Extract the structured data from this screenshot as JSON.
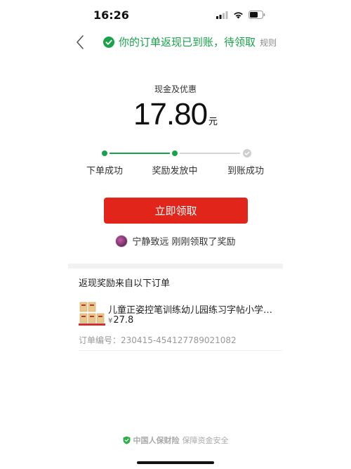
{
  "status_bar": {
    "time": "16:26"
  },
  "nav": {
    "title": "你的订单返现已到账，待领取",
    "rules": "规则"
  },
  "reward": {
    "label": "现金及优惠",
    "amount": "17.80",
    "unit": "元"
  },
  "progress": {
    "steps": [
      {
        "label": "下单成功",
        "state": "done"
      },
      {
        "label": "奖励发放中",
        "state": "current"
      },
      {
        "label": "到账成功",
        "state": "pending"
      }
    ]
  },
  "claim_button": "立即领取",
  "notice": {
    "text": "宁静致远 刚刚领取了奖励"
  },
  "orders_section": {
    "title": "返现奖励来自以下订单",
    "order": {
      "name": "儿童正姿控笔训练幼儿园练习字帖小学生描红...",
      "currency": "¥",
      "price": "27.8",
      "order_no_label": "订单编号：",
      "order_no": "230415-454127789021082"
    }
  },
  "footer": {
    "brand": "中国人保财险",
    "text": "保障资金安全"
  },
  "colors": {
    "accent_green": "#18a34a",
    "button_red": "#e1251b",
    "progress_pending": "#cfcfcf"
  }
}
